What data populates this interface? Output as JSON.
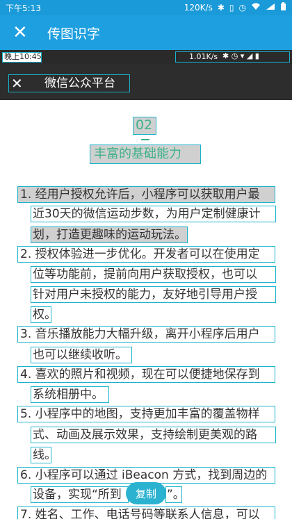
{
  "status_bar": {
    "time": "下午5:13",
    "speed": "120K/s",
    "icons": [
      "bluetooth-icon",
      "vibrate-icon",
      "alarm-icon",
      "wifi-icon",
      "signal-icon",
      "battery-icon"
    ]
  },
  "app_bar": {
    "title": "传图识字",
    "close_icon": "close-icon"
  },
  "screenshot": {
    "status_time": "晚上10:45",
    "status_speed": "1.01K/s",
    "header_title": "微信公众平台",
    "section_number": "02",
    "section_title": "丰富的基础能力",
    "lines": [
      "1. 经用户授权允许后，小程序可以获取用户最",
      "近30天的微信运动步数，为用户定制健康计",
      "划，打造更趣味的运动玩法。",
      "2. 授权体验进一步优化。开发者可以在使用定",
      "位等功能前，提前向用户获取授权，也可以",
      "针对用户未授权的能力，友好地引导用户授",
      "权。",
      "3. 音乐播放能力大幅升级，离开小程序后用户",
      "也可以继续收听。",
      "4. 喜欢的照片和视频，现在可以便捷地保存到",
      "系统相册中。",
      "5. 小程序中的地图，支持更加丰富的覆盖物样",
      "式、动画及展示效果，支持绘制更美观的路",
      "线。",
      "6. 小程序可以通过 iBeacon 方式，找到周边的",
      "设备，实现“所到",
      "”。",
      "7. 姓名、工作、电话号码等联系人信息，可以"
    ]
  },
  "copy_button": "复制",
  "colors": {
    "app_bar": "#1e9fe0",
    "highlight_box": "#18b3cc",
    "accent_green": "#3db08a",
    "copy_button": "#2bb2d0"
  }
}
